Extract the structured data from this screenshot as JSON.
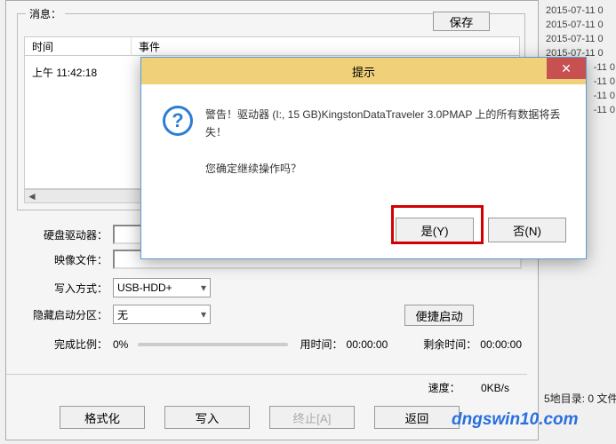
{
  "message": {
    "group_label": "消息：",
    "save": "保存",
    "col_time": "时间",
    "col_event": "事件",
    "row_time": "上午 11:42:18"
  },
  "labels": {
    "drive": "硬盘驱动器：",
    "image": "映像文件：",
    "write_mode": "写入方式：",
    "hide_part": "隐藏启动分区：",
    "quick_boot": "便捷启动",
    "done": "完成比例：",
    "used": "用时间：",
    "remain": "剩余时间：",
    "speed": "速度：",
    "pct": "0%",
    "t_used": "00:00:00",
    "t_remain": "00:00:00",
    "speed_val": "0KB/s"
  },
  "select": {
    "write_mode": "USB-HDD+",
    "hide_part": "无"
  },
  "buttons": {
    "format": "格式化",
    "write": "写入",
    "stop": "终止[A]",
    "back": "返回"
  },
  "sidelog": [
    "2015-07-11 0",
    "2015-07-11 0",
    "2015-07-11 0",
    "2015-07-11 0",
    "-11 0",
    "-11 0",
    "-11 0",
    "-11 0"
  ],
  "dir_count": "5地目录: 0 文件,",
  "dialog": {
    "title": "提示",
    "line1": "警告！驱动器 (I:, 15 GB)KingstonDataTraveler 3.0PMAP 上的所有数据将丢失！",
    "line2": "您确定继续操作吗？",
    "yes": "是(Y)",
    "no": "否(N)"
  },
  "watermark": "dngswin10.com"
}
